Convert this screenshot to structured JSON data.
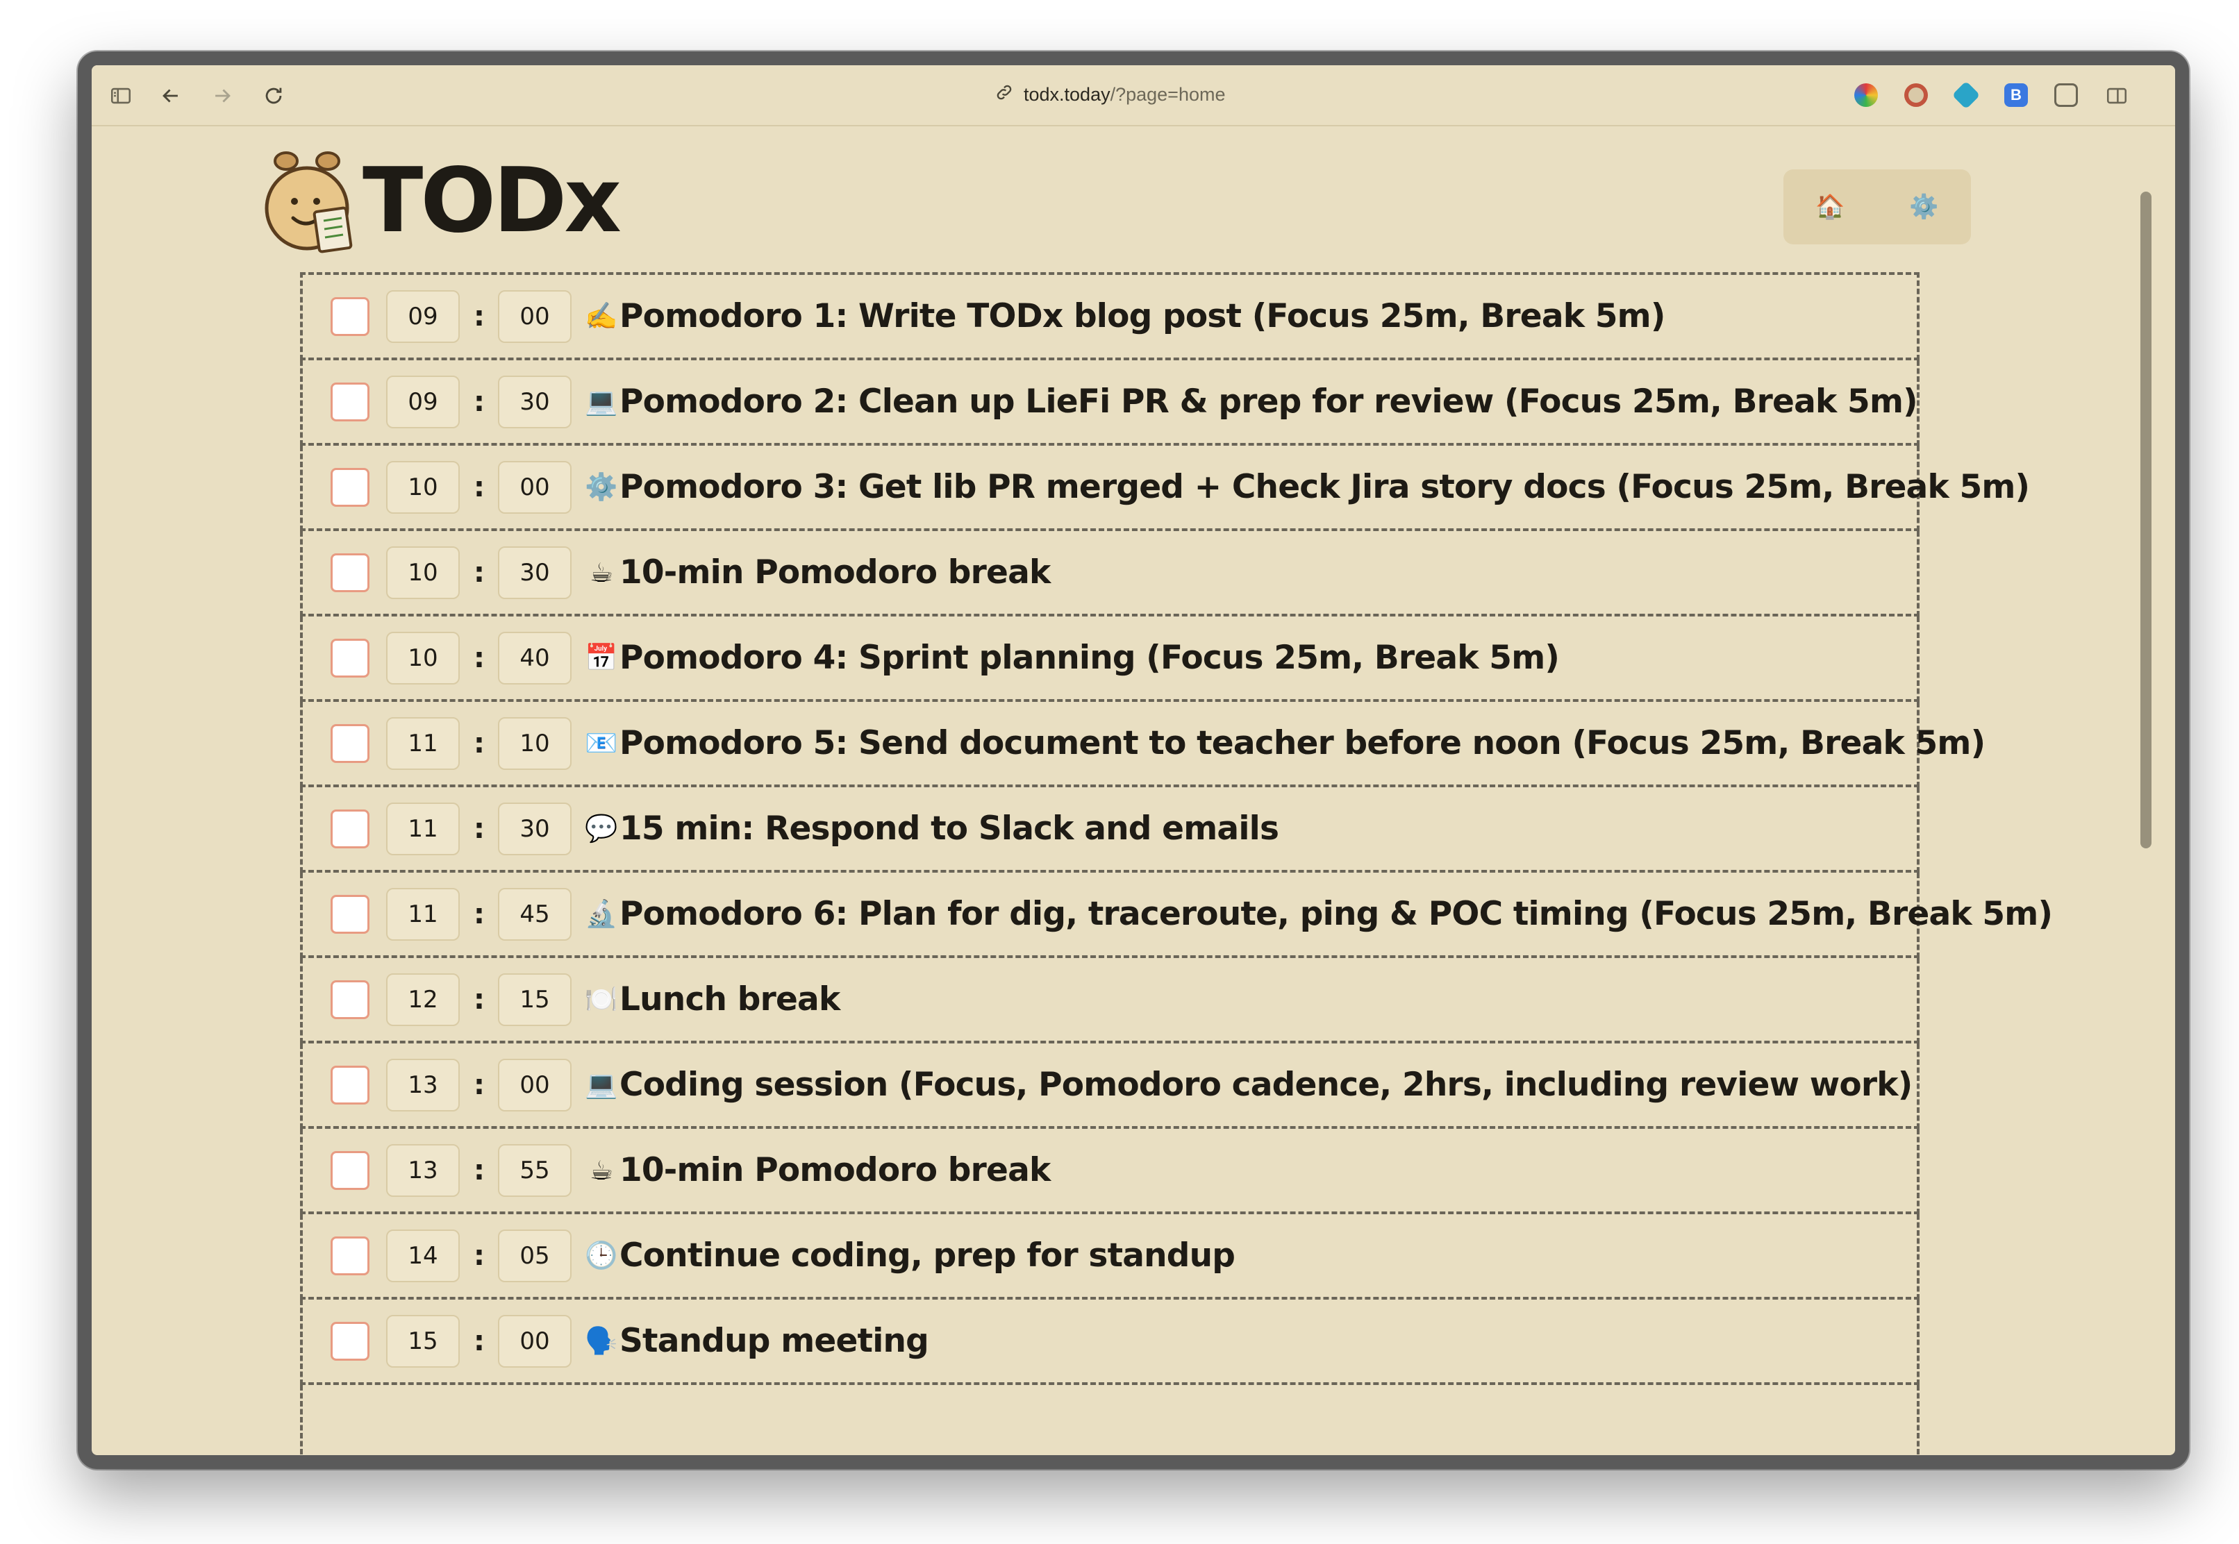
{
  "browser": {
    "url_domain": "todx.today",
    "url_path": "/?page=home"
  },
  "app": {
    "brand": "TODx"
  },
  "nav": {
    "home_icon": "🏠",
    "settings_icon": "⚙️"
  },
  "tasks": [
    {
      "hour": "09",
      "minute": "00",
      "emoji": "✍️",
      "title": "Pomodoro 1: Write TODx blog post (Focus 25m, Break 5m)"
    },
    {
      "hour": "09",
      "minute": "30",
      "emoji": "💻",
      "title": "Pomodoro 2: Clean up LieFi PR & prep for review (Focus 25m, Break 5m)"
    },
    {
      "hour": "10",
      "minute": "00",
      "emoji": "⚙️",
      "title": "Pomodoro 3: Get lib PR merged + Check Jira story docs (Focus 25m, Break 5m)"
    },
    {
      "hour": "10",
      "minute": "30",
      "emoji": "☕",
      "title": "10-min Pomodoro break"
    },
    {
      "hour": "10",
      "minute": "40",
      "emoji": "📅",
      "title": "Pomodoro 4: Sprint planning (Focus 25m, Break 5m)"
    },
    {
      "hour": "11",
      "minute": "10",
      "emoji": "📧",
      "title": "Pomodoro 5: Send document to teacher before noon (Focus 25m, Break 5m)"
    },
    {
      "hour": "11",
      "minute": "30",
      "emoji": "💬",
      "title": "15 min: Respond to Slack and emails"
    },
    {
      "hour": "11",
      "minute": "45",
      "emoji": "🔬",
      "title": "Pomodoro 6: Plan for dig, traceroute, ping & POC timing (Focus 25m, Break 5m)"
    },
    {
      "hour": "12",
      "minute": "15",
      "emoji": "🍽️",
      "title": "Lunch break"
    },
    {
      "hour": "13",
      "minute": "00",
      "emoji": "💻",
      "title": "Coding session (Focus, Pomodoro cadence, 2hrs, including review work)"
    },
    {
      "hour": "13",
      "minute": "55",
      "emoji": "☕",
      "title": "10-min Pomodoro break"
    },
    {
      "hour": "14",
      "minute": "05",
      "emoji": "🕒",
      "title": "Continue coding, prep for standup"
    },
    {
      "hour": "15",
      "minute": "00",
      "emoji": "🗣️",
      "title": "Standup meeting"
    }
  ]
}
